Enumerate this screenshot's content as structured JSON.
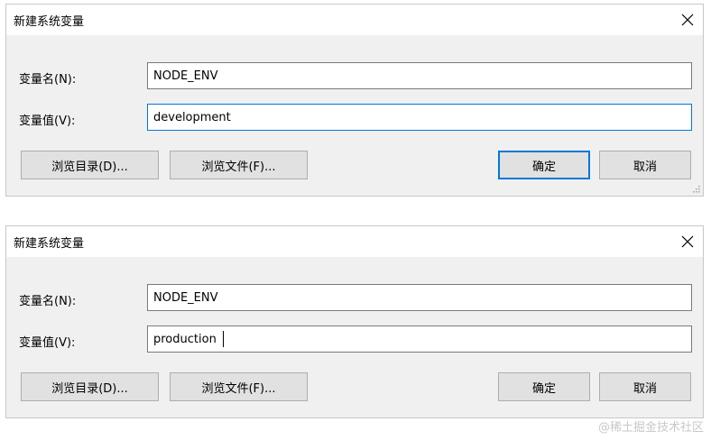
{
  "dialogs": [
    {
      "title": "新建系统变量",
      "name_label": "变量名(N):",
      "value_label": "变量值(V):",
      "name_value": "NODE_ENV",
      "value_value": "development",
      "browse_dir_label": "浏览目录(D)...",
      "browse_file_label": "浏览文件(F)...",
      "ok_label": "确定",
      "cancel_label": "取消"
    },
    {
      "title": "新建系统变量",
      "name_label": "变量名(N):",
      "value_label": "变量值(V):",
      "name_value": "NODE_ENV",
      "value_value": "production",
      "browse_dir_label": "浏览目录(D)...",
      "browse_file_label": "浏览文件(F)...",
      "ok_label": "确定",
      "cancel_label": "取消"
    }
  ],
  "watermark": "@稀土掘金技术社区",
  "icons": {
    "close": "close-icon",
    "grip": "resize-grip-icon"
  },
  "colors": {
    "focus_border": "#0078d7",
    "dialog_bg": "#f0f0f0",
    "button_bg": "#e1e1e1"
  }
}
